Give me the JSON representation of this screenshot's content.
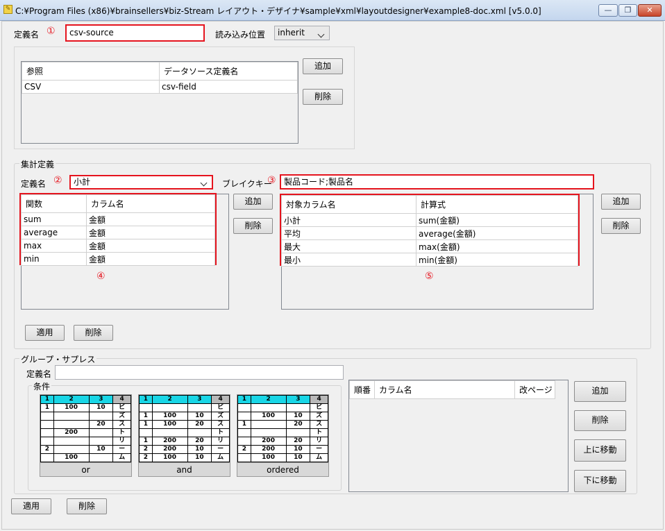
{
  "window": {
    "title": "C:¥Program Files (x86)¥brainsellers¥biz-Stream レイアウト・デザイナ¥sample¥xml¥layoutdesigner¥example8-doc.xml [v5.0.0]",
    "min_label": "—",
    "max_label": "❐",
    "close_label": "✕"
  },
  "definition": {
    "name_label": "定義名",
    "name_value": "csv-source",
    "marker": "①",
    "read_position_label": "読み込み位置",
    "read_position_value": "inherit"
  },
  "reference": {
    "columns": [
      "参照",
      "データソース定義名"
    ],
    "rows": [
      [
        "CSV",
        "csv-field"
      ]
    ],
    "add_label": "追加",
    "delete_label": "削除"
  },
  "aggregate": {
    "group_label": "集計定義",
    "name_label": "定義名",
    "name_marker": "②",
    "name_value": "小計",
    "break_key_label": "ブレイクキー",
    "break_key_marker": "③",
    "break_key_value": "製品コード;製品名",
    "left_table": {
      "columns": [
        "関数",
        "カラム名"
      ],
      "rows": [
        [
          "sum",
          "金額"
        ],
        [
          "average",
          "金額"
        ],
        [
          "max",
          "金額"
        ],
        [
          "min",
          "金額"
        ]
      ],
      "marker": "④"
    },
    "right_table": {
      "columns": [
        "対象カラム名",
        "計算式"
      ],
      "rows": [
        [
          "小計",
          "sum(金額)"
        ],
        [
          "平均",
          "average(金額)"
        ],
        [
          "最大",
          "max(金額)"
        ],
        [
          "最小",
          "min(金額)"
        ]
      ],
      "marker": "⑤"
    },
    "add_label": "追加",
    "delete_label": "削除",
    "apply_label": "適用",
    "bottom_delete_label": "削除"
  },
  "group_suppress": {
    "group_label": "グループ・サプレス",
    "name_label": "定義名",
    "name_value": "",
    "condition_label": "条件",
    "conditions": [
      {
        "caption": "or",
        "header": [
          "1",
          "2",
          "3",
          "4"
        ],
        "rows": [
          [
            "1",
            "100",
            "10",
            "ビ"
          ],
          [
            "",
            "",
            "",
            "ズ"
          ],
          [
            "",
            "",
            "20",
            "ス"
          ],
          [
            "",
            "200",
            "",
            "ト"
          ],
          [
            "",
            "",
            "",
            "リ"
          ],
          [
            "2",
            "",
            "10",
            "ー"
          ],
          [
            "",
            "100",
            "",
            "ム"
          ]
        ]
      },
      {
        "caption": "and",
        "header": [
          "1",
          "2",
          "3",
          "4"
        ],
        "rows": [
          [
            "",
            "",
            "",
            "ビ"
          ],
          [
            "1",
            "100",
            "10",
            "ズ"
          ],
          [
            "1",
            "100",
            "20",
            "ス"
          ],
          [
            "",
            "",
            "",
            "ト"
          ],
          [
            "1",
            "200",
            "20",
            "リ"
          ],
          [
            "2",
            "200",
            "10",
            "ー"
          ],
          [
            "2",
            "100",
            "10",
            "ム"
          ]
        ]
      },
      {
        "caption": "ordered",
        "header": [
          "1",
          "2",
          "3",
          "4"
        ],
        "rows": [
          [
            "",
            "",
            "",
            "ビ"
          ],
          [
            "",
            "100",
            "10",
            "ズ"
          ],
          [
            "1",
            "",
            "20",
            "ス"
          ],
          [
            "",
            "",
            "",
            "ト"
          ],
          [
            "",
            "200",
            "20",
            "リ"
          ],
          [
            "2",
            "200",
            "10",
            "ー"
          ],
          [
            "",
            "100",
            "10",
            "ム"
          ]
        ]
      }
    ],
    "list_columns": [
      "順番",
      "カラム名",
      "改ページ"
    ],
    "add_label": "追加",
    "delete_label": "削除",
    "move_up_label": "上に移動",
    "move_down_label": "下に移動"
  },
  "footer": {
    "apply_label": "適用",
    "delete_label": "削除"
  }
}
